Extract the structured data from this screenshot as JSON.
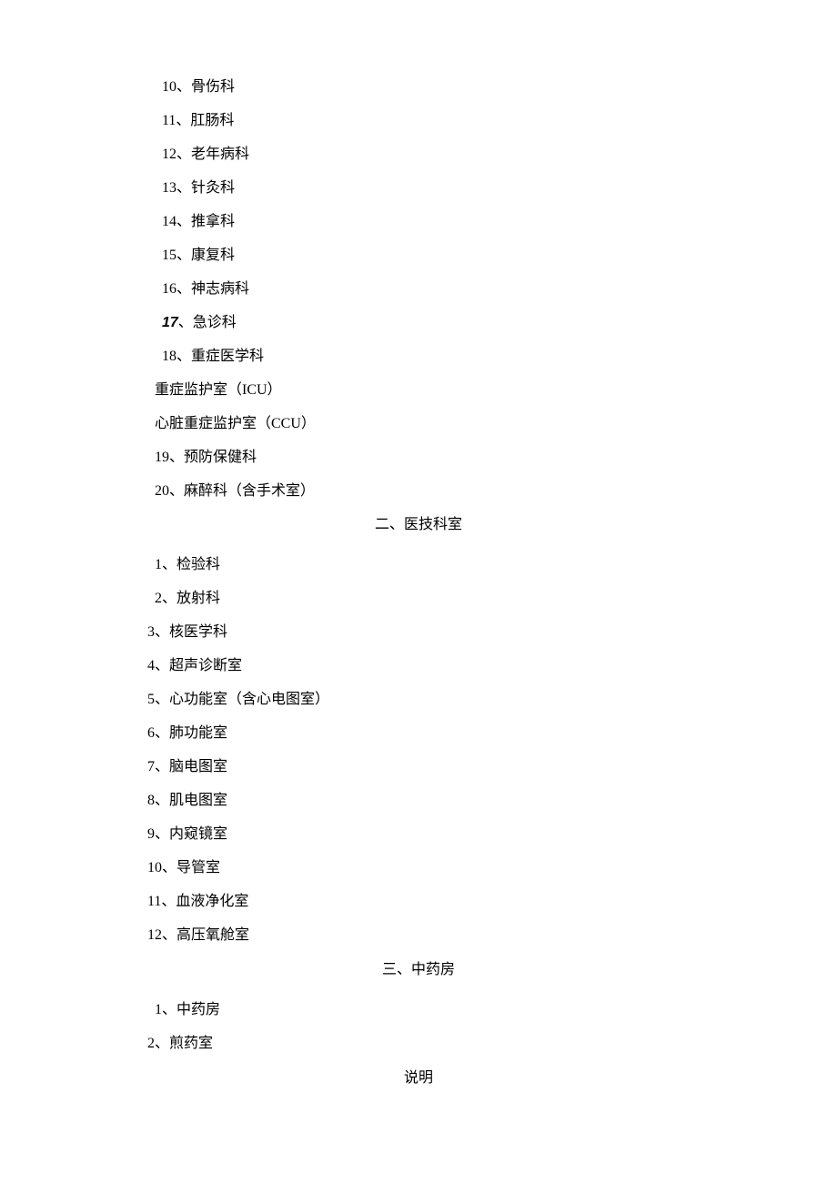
{
  "section1": {
    "items": [
      "10、骨伤科",
      "11、肛肠科",
      "12、老年病科",
      "13、针灸科",
      "14、推拿科",
      "15、康复科",
      "16、神志病科"
    ],
    "item17_num": "17",
    "item17_text": "、急诊科",
    "items2": [
      "18、重症医学科"
    ],
    "subitems": [
      "重症监护室（ICU）",
      "心脏重症监护室（CCU）",
      "19、预防保健科",
      "20、麻醉科（含手术室）"
    ]
  },
  "heading2": "二、医技科室",
  "section2": {
    "items1": [
      "1、检验科",
      "2、放射科"
    ],
    "items2": [
      "3、核医学科",
      "4、超声诊断室",
      "5、心功能室（含心电图室）",
      "6、肺功能室",
      "7、脑电图室",
      "8、肌电图室",
      "9、内窥镜室",
      "10、导管室",
      "11、血液净化室",
      "12、高压氧舱室"
    ]
  },
  "heading3": "三、中药房",
  "section3": {
    "items1": [
      "1、中药房"
    ],
    "items2": [
      "2、煎药室"
    ]
  },
  "heading4": "说明"
}
